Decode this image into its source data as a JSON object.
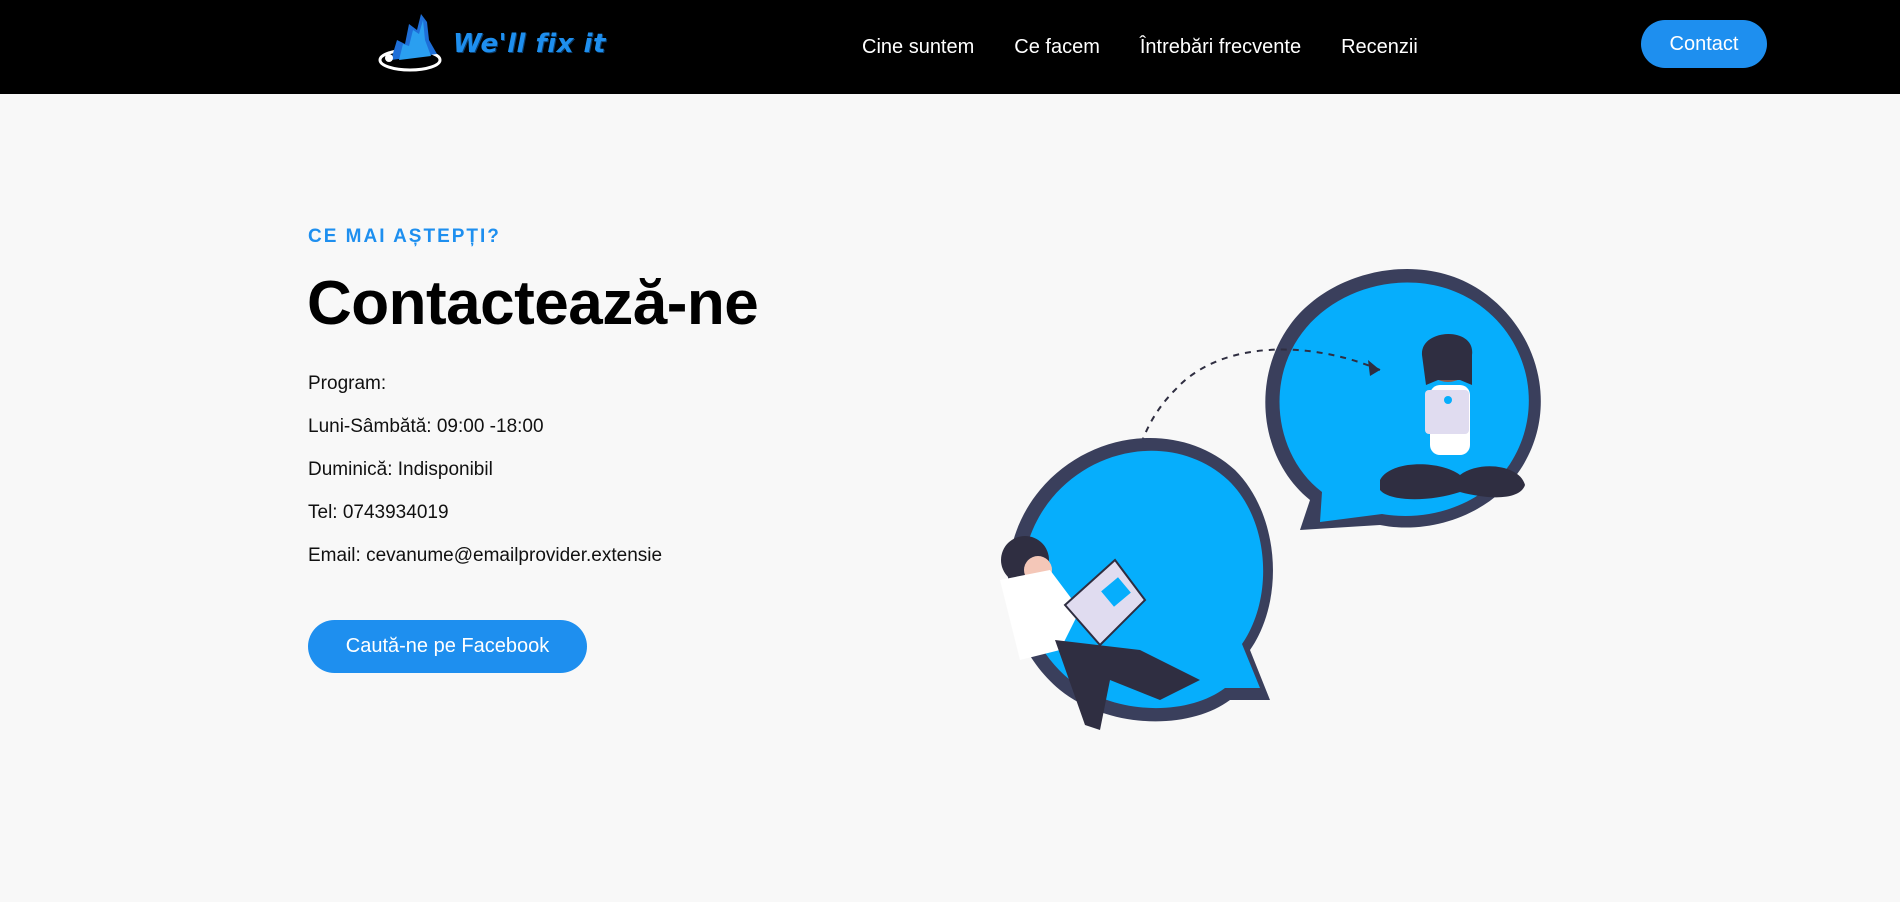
{
  "brand": {
    "logo_text": "We'll fix it",
    "accent_color": "#1e8fef"
  },
  "nav": {
    "links": [
      {
        "label": "Cine suntem"
      },
      {
        "label": "Ce facem"
      },
      {
        "label": "Întrebări frecvente"
      },
      {
        "label": "Recenzii"
      }
    ],
    "contact_label": "Contact"
  },
  "hero": {
    "eyebrow": "CE MAI AȘTEPȚI?",
    "title": "Contactează-ne",
    "lines": [
      "Program:",
      "Luni-Sâmbătă: 09:00 -18:00",
      "Duminică: Indisponibil",
      "Tel: 0743934019",
      "Email: cevanume@emailprovider.extensie"
    ],
    "facebook_button": "Caută-ne pe Facebook"
  },
  "illustration": {
    "name": "chat-bubbles-illustration"
  }
}
